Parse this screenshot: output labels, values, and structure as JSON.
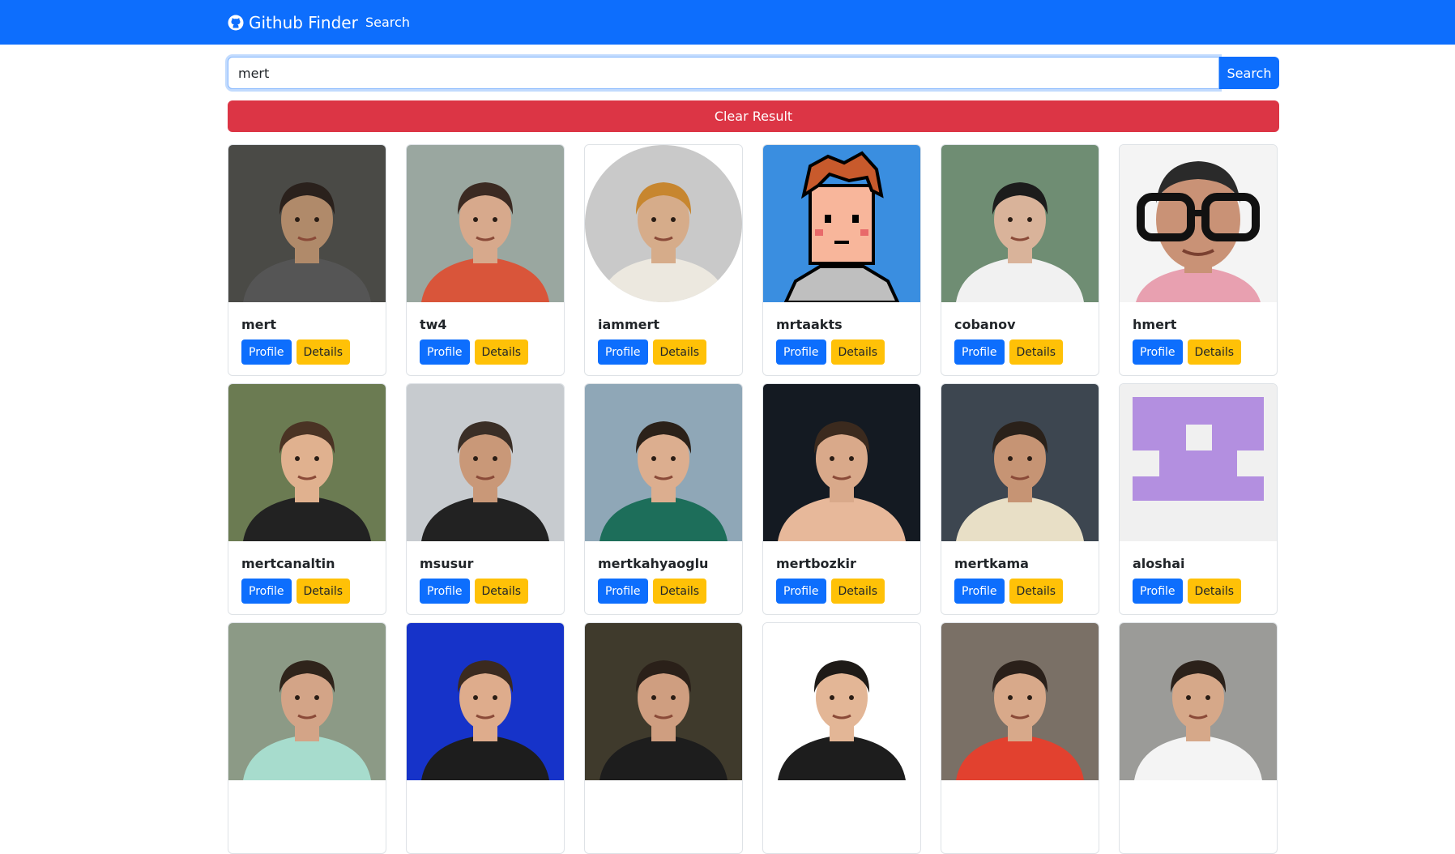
{
  "navbar": {
    "brand": "Github Finder",
    "brand_icon": "github-icon",
    "links": [
      "Search"
    ]
  },
  "search": {
    "value": "mert",
    "button_label": "Search"
  },
  "clear_button_label": "Clear Result",
  "colors": {
    "primary": "#0d6efd",
    "danger": "#dc3545",
    "warning": "#ffc107"
  },
  "profile_label": "Profile",
  "details_label": "Details",
  "users": [
    {
      "login": "mert",
      "avatar": "photo",
      "bg": "#4a4a46",
      "skin": "#b08a6a",
      "shirt": "#555555",
      "hair": "#2a211c"
    },
    {
      "login": "tw4",
      "avatar": "photo",
      "bg": "#9aa7a0",
      "skin": "#d7a98c",
      "shirt": "#d9553a",
      "hair": "#3b2a22"
    },
    {
      "login": "iammert",
      "avatar": "photo-round",
      "bg": "#c9c9c9",
      "skin": "#d6ac8a",
      "shirt": "#ece8df",
      "hair": "#c7862f"
    },
    {
      "login": "mrtaakts",
      "avatar": "pixel",
      "bg": "#3a8ee0",
      "skin": "#f8b69b",
      "shirt": "#bfbfbf",
      "hair": "#c85a2c"
    },
    {
      "login": "cobanov",
      "avatar": "photo",
      "bg": "#6f8d73",
      "skin": "#d9b39a",
      "shirt": "#f1f1f1",
      "hair": "#1c1c1c"
    },
    {
      "login": "hmert",
      "avatar": "glasses",
      "bg": "#f4f4f4",
      "skin": "#c99276",
      "shirt": "#e8a0b0",
      "hair": "#2a2a2a"
    },
    {
      "login": "mertcanaltin",
      "avatar": "photo",
      "bg": "#6b7b52",
      "skin": "#e0b18f",
      "shirt": "#222222",
      "hair": "#4a3324"
    },
    {
      "login": "msusur",
      "avatar": "photo",
      "bg": "#c7cbcf",
      "skin": "#c99878",
      "shirt": "#222222",
      "hair": "#3a2e26"
    },
    {
      "login": "mertkahyaoglu",
      "avatar": "photo",
      "bg": "#8fa7b7",
      "skin": "#dcae8f",
      "shirt": "#1d6e5a",
      "hair": "#2b2119"
    },
    {
      "login": "mertbozkir",
      "avatar": "photo",
      "bg": "#141a22",
      "skin": "#d9a98a",
      "shirt": "#e7b89a",
      "hair": "#3b2a1e"
    },
    {
      "login": "mertkama",
      "avatar": "photo",
      "bg": "#3d4650",
      "skin": "#c69474",
      "shirt": "#e8dfc6",
      "hair": "#2a211a"
    },
    {
      "login": "aloshai",
      "avatar": "identicon",
      "bg": "#f0f0f0",
      "skin": "#b38fe0",
      "shirt": "#b38fe0",
      "hair": "#b38fe0"
    },
    {
      "login": "",
      "avatar": "photo",
      "bg": "#8c9a86",
      "skin": "#d3a487",
      "shirt": "#a7dccd",
      "hair": "#2f241b"
    },
    {
      "login": "",
      "avatar": "photo",
      "bg": "#1633c9",
      "skin": "#deac8c",
      "shirt": "#1d1d1d",
      "hair": "#3b2a1f"
    },
    {
      "login": "",
      "avatar": "photo",
      "bg": "#3f3a2c",
      "skin": "#cf9e80",
      "shirt": "#1d1d1d",
      "hair": "#2a2019"
    },
    {
      "login": "",
      "avatar": "photo",
      "bg": "#ffffff",
      "skin": "#e3b696",
      "shirt": "#1d1d1d",
      "hair": "#1e1a17"
    },
    {
      "login": "",
      "avatar": "photo",
      "bg": "#7a7066",
      "skin": "#d8a98a",
      "shirt": "#e2412f",
      "hair": "#2a201a"
    },
    {
      "login": "",
      "avatar": "photo",
      "bg": "#9b9b98",
      "skin": "#d6a889",
      "shirt": "#f4f4f4",
      "hair": "#2b211a"
    }
  ]
}
